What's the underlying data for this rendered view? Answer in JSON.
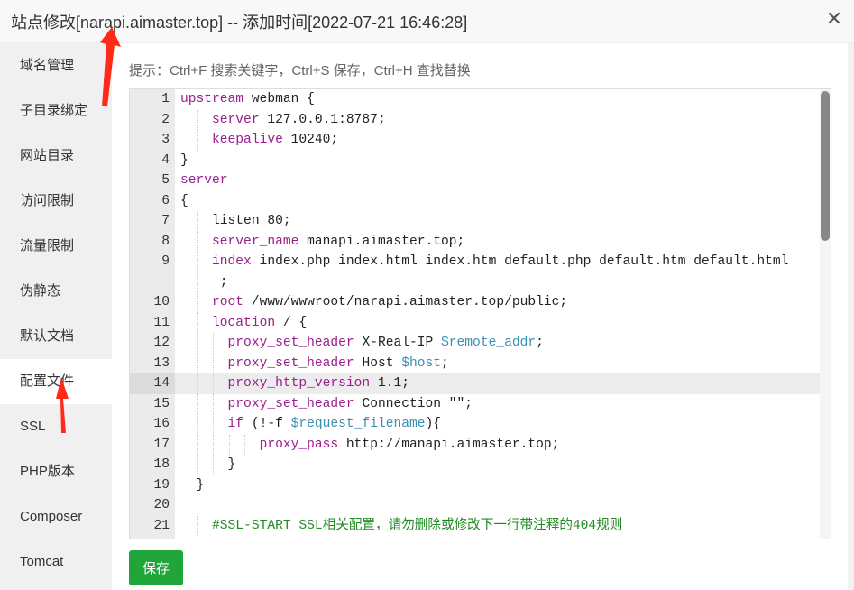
{
  "title": "站点修改[narapi.aimaster.top] -- 添加时间[2022-07-21 16:46:28]",
  "close_icon": "close-icon",
  "sidebar": {
    "items": [
      {
        "label": "域名管理"
      },
      {
        "label": "子目录绑定"
      },
      {
        "label": "网站目录"
      },
      {
        "label": "访问限制"
      },
      {
        "label": "流量限制"
      },
      {
        "label": "伪静态"
      },
      {
        "label": "默认文档"
      },
      {
        "label": "配置文件",
        "active": true
      },
      {
        "label": "SSL"
      },
      {
        "label": "PHP版本"
      },
      {
        "label": "Composer"
      },
      {
        "label": "Tomcat"
      }
    ]
  },
  "hint": "提示：Ctrl+F 搜索关键字，Ctrl+S 保存，Ctrl+H 查找替换",
  "editor": {
    "highlight_line": 14,
    "lines": [
      {
        "n": "1",
        "indent": 0,
        "t": [
          [
            "kw",
            "upstream"
          ],
          [
            "",
            "webman {"
          ]
        ]
      },
      {
        "n": "2",
        "indent": 4,
        "t": [
          [
            "kw",
            "server"
          ],
          [
            "",
            "127.0.0.1:8787;"
          ]
        ]
      },
      {
        "n": "3",
        "indent": 4,
        "t": [
          [
            "kw",
            "keepalive"
          ],
          [
            "",
            "10240;"
          ]
        ]
      },
      {
        "n": "4",
        "indent": 0,
        "t": [
          [
            "",
            "}"
          ]
        ]
      },
      {
        "n": "5",
        "indent": 0,
        "t": [
          [
            "kw",
            "server"
          ]
        ]
      },
      {
        "n": "6",
        "indent": 0,
        "t": [
          [
            "",
            "{"
          ]
        ]
      },
      {
        "n": "7",
        "indent": 4,
        "t": [
          [
            "",
            "listen 80;"
          ]
        ]
      },
      {
        "n": "8",
        "indent": 4,
        "t": [
          [
            "kw",
            "server_name"
          ],
          [
            "",
            "manapi.aimaster.top;"
          ]
        ]
      },
      {
        "n": "9",
        "indent": 4,
        "wrap": true,
        "t": [
          [
            "kw",
            "index"
          ],
          [
            "",
            "index.php index.html index.htm default.php default.htm default.html\n     ;"
          ]
        ]
      },
      {
        "n": "10",
        "indent": 4,
        "t": [
          [
            "kw",
            "root"
          ],
          [
            "",
            "/www/wwwroot/narapi.aimaster.top/public;"
          ]
        ]
      },
      {
        "n": "11",
        "indent": 4,
        "t": [
          [
            "kw",
            "location"
          ],
          [
            "",
            "/ {"
          ]
        ]
      },
      {
        "n": "12",
        "indent": 6,
        "t": [
          [
            "kw",
            "proxy_set_header"
          ],
          [
            "",
            "X-Real-IP"
          ],
          [
            "var",
            "$remote_addr"
          ],
          [
            "",
            ";"
          ]
        ]
      },
      {
        "n": "13",
        "indent": 6,
        "t": [
          [
            "kw",
            "proxy_set_header"
          ],
          [
            "",
            "Host"
          ],
          [
            "var",
            "$host"
          ],
          [
            "",
            ";"
          ]
        ]
      },
      {
        "n": "14",
        "indent": 6,
        "t": [
          [
            "kw",
            "proxy_http_version"
          ],
          [
            "",
            "1.1;"
          ]
        ]
      },
      {
        "n": "15",
        "indent": 6,
        "t": [
          [
            "kw",
            "proxy_set_header"
          ],
          [
            "",
            "Connection \"\";"
          ]
        ]
      },
      {
        "n": "16",
        "indent": 6,
        "t": [
          [
            "kw",
            "if"
          ],
          [
            "",
            "(!-f"
          ],
          [
            "var",
            "$request_filename"
          ],
          [
            "",
            "){"
          ]
        ]
      },
      {
        "n": "17",
        "indent": 10,
        "t": [
          [
            "kw",
            "proxy_pass"
          ],
          [
            "",
            "http://manapi.aimaster.top;"
          ]
        ]
      },
      {
        "n": "18",
        "indent": 6,
        "t": [
          [
            "",
            "}"
          ]
        ]
      },
      {
        "n": "19",
        "indent": 2,
        "t": [
          [
            "",
            "}"
          ]
        ]
      },
      {
        "n": "20",
        "indent": 0,
        "t": []
      },
      {
        "n": "21",
        "indent": 4,
        "t": [
          [
            "cm",
            "#SSL-START SSL相关配置，请勿删除或修改下一行带注释的404规则"
          ]
        ]
      }
    ]
  },
  "save_label": "保存",
  "colors": {
    "accent": "#20a53a",
    "keyword": "#9b1e8e",
    "variable": "#3a8fb0",
    "comment": "#228b22",
    "annotation_arrow": "#ff2a1a"
  }
}
